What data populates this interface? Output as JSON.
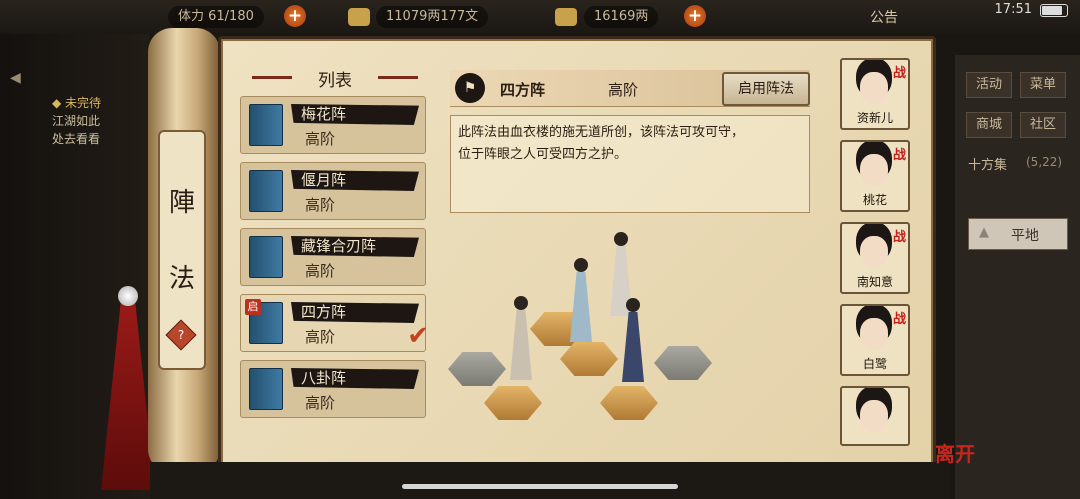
{
  "hud": {
    "stamina": "体力 61/180",
    "silver": "11079两177文",
    "gold": "16169两",
    "notice": "公告",
    "time": "17:51"
  },
  "left_quest": {
    "header": "◆ 未完待",
    "line1": "江湖如此",
    "line2": "处去看看"
  },
  "scroll_tab": {
    "chars": [
      "陣",
      "法"
    ],
    "help": "?"
  },
  "list": {
    "header": "列表",
    "items": [
      {
        "name": "梅花阵",
        "level": "高阶",
        "active": false
      },
      {
        "name": "偃月阵",
        "level": "高阶",
        "active": false
      },
      {
        "name": "藏锋合刃阵",
        "level": "高阶",
        "active": false
      },
      {
        "name": "四方阵",
        "level": "高阶",
        "active": true,
        "badge": "启"
      },
      {
        "name": "八卦阵",
        "level": "高阶",
        "active": false
      }
    ]
  },
  "detail": {
    "name": "四方阵",
    "level": "高阶",
    "enable_label": "启用阵法",
    "description_line1": "此阵法由血衣楼的施无道所创，该阵法可攻可守，",
    "description_line2": "位于阵眼之人可受四方之护。"
  },
  "members": [
    {
      "name": "资新儿",
      "tag": "战"
    },
    {
      "name": "桃花",
      "tag": "战"
    },
    {
      "name": "南知意",
      "tag": "战"
    },
    {
      "name": "白鹭",
      "tag": "战"
    },
    {
      "name": "",
      "tag": ""
    }
  ],
  "right_menu": {
    "btn1": "活动",
    "btn2": "菜单",
    "btn3": "商城",
    "btn4": "社区",
    "location": "十方集",
    "coords": "(5,22)",
    "terrain": "平地"
  },
  "leave": "离开",
  "colors": {
    "accent_red": "#c3201c",
    "paper": "#efe2c2",
    "ink": "#1d1612"
  }
}
